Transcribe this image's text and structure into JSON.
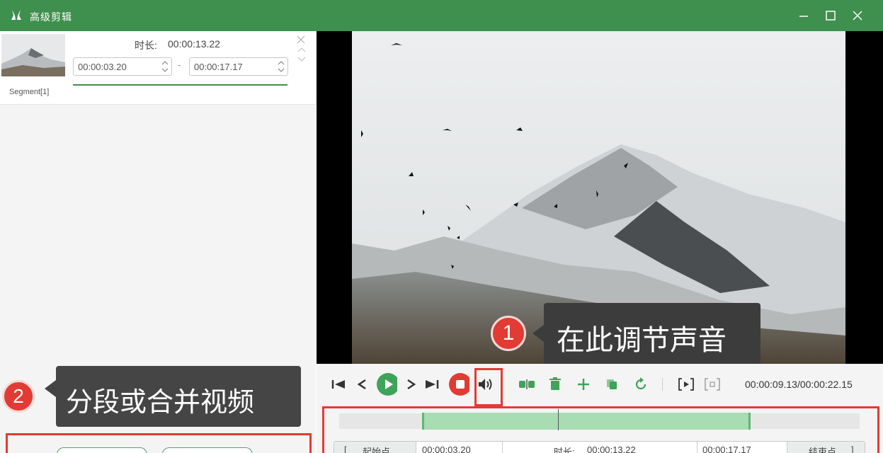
{
  "window": {
    "title": "高级剪辑",
    "accent_color": "#3f8f4e",
    "icons": [
      "rabbit-logo-icon",
      "minimize-icon",
      "maximize-icon",
      "close-icon"
    ]
  },
  "segment": {
    "name": "Segment[1]",
    "duration_label": "时长:",
    "duration_value": "00:00:13.22",
    "start_time": "00:00:03.20",
    "end_time": "00:00:17.17",
    "separator": "-",
    "progress": 1.0
  },
  "annotation_1": {
    "number": "1",
    "text": "在此调节声音"
  },
  "annotation_2": {
    "number": "2",
    "text": "分段或合并视频"
  },
  "player": {
    "time_readout": "00:00:09.13/00:00:22.15",
    "play_color": "#3fa35a",
    "stop_color": "#e23b33"
  },
  "timeline": {
    "start_point_label": "起始点",
    "start_time": "00:00:03.20",
    "duration_label": "时长:",
    "duration_value": "00:00:13.22",
    "end_time": "00:00:17.17",
    "end_point_label": "结束点"
  }
}
